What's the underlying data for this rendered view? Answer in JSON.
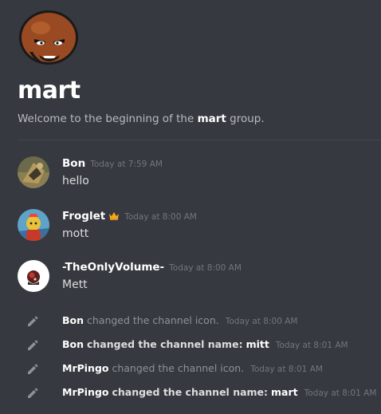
{
  "group": {
    "name": "mart",
    "icon": "group-avatar-icon",
    "welcome_prefix": "Welcome to the beginning of the",
    "welcome_name": "mart",
    "welcome_suffix": "group."
  },
  "messages": [
    {
      "author": "Bon",
      "timestamp": "Today at 7:59 AM",
      "text": "hello",
      "badge": ""
    },
    {
      "author": "Froglet",
      "timestamp": "Today at 8:00 AM",
      "text": "mott",
      "badge": "crown-icon"
    },
    {
      "author": "-TheOnlyVolume-",
      "timestamp": "Today at 8:00 AM",
      "text": "Mett",
      "badge": ""
    }
  ],
  "system_messages": [
    {
      "user": "Bon",
      "action": "changed the channel icon.",
      "detail": "",
      "timestamp": "Today at 8:00 AM"
    },
    {
      "user": "Bon",
      "action": "changed the channel name:",
      "detail": "mitt",
      "timestamp": "Today at 8:01 AM"
    },
    {
      "user": "MrPingo",
      "action": "changed the channel icon.",
      "detail": "",
      "timestamp": "Today at 8:01 AM"
    },
    {
      "user": "MrPingo",
      "action": "changed the channel name:",
      "detail": "mart",
      "timestamp": "Today at 8:01 AM"
    }
  ],
  "colors": {
    "background": "#36393f",
    "username": "#ffffff",
    "timestamp": "#72767d",
    "crown": "#faa61a"
  }
}
